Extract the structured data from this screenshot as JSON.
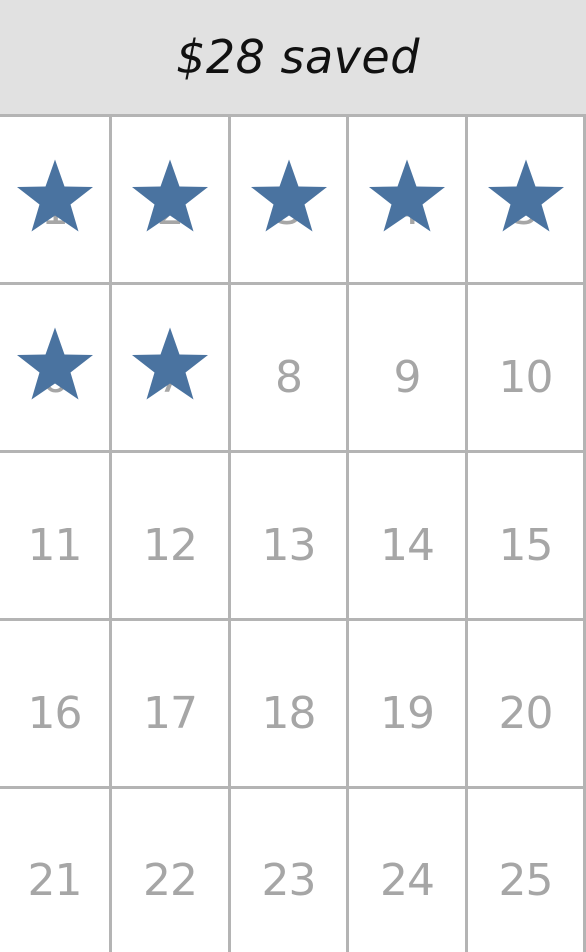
{
  "header": {
    "savings_text": "$28 saved"
  },
  "calendar": {
    "star_color": "#4a73a0",
    "number_color": "#a6a6a6",
    "grid_color": "#b4b4b4",
    "days": [
      {
        "label": "1",
        "starred": true
      },
      {
        "label": "2",
        "starred": true
      },
      {
        "label": "3",
        "starred": true
      },
      {
        "label": "4",
        "starred": true
      },
      {
        "label": "5",
        "starred": true
      },
      {
        "label": "6",
        "starred": true
      },
      {
        "label": "7",
        "starred": true
      },
      {
        "label": "8",
        "starred": false
      },
      {
        "label": "9",
        "starred": false
      },
      {
        "label": "10",
        "starred": false
      },
      {
        "label": "11",
        "starred": false
      },
      {
        "label": "12",
        "starred": false
      },
      {
        "label": "13",
        "starred": false
      },
      {
        "label": "14",
        "starred": false
      },
      {
        "label": "15",
        "starred": false
      },
      {
        "label": "16",
        "starred": false
      },
      {
        "label": "17",
        "starred": false
      },
      {
        "label": "18",
        "starred": false
      },
      {
        "label": "19",
        "starred": false
      },
      {
        "label": "20",
        "starred": false
      },
      {
        "label": "21",
        "starred": false
      },
      {
        "label": "22",
        "starred": false
      },
      {
        "label": "23",
        "starred": false
      },
      {
        "label": "24",
        "starred": false
      },
      {
        "label": "25",
        "starred": false
      }
    ]
  }
}
